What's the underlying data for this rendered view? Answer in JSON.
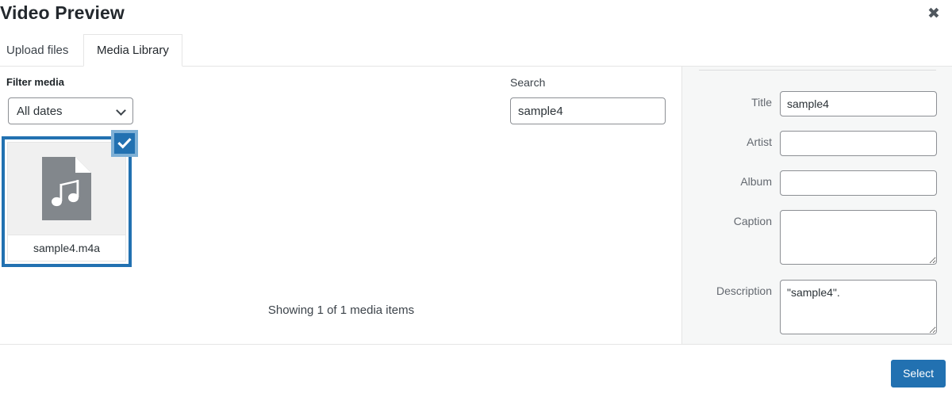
{
  "modal": {
    "title": "Video Preview",
    "close_label": "✖"
  },
  "tabs": [
    {
      "label": "Upload files",
      "active": false
    },
    {
      "label": "Media Library",
      "active": true
    }
  ],
  "toolbar": {
    "filter_label": "Filter media",
    "date_filter_value": "All dates",
    "date_filter_options": [
      "All dates"
    ],
    "search_label": "Search",
    "search_value": "sample4",
    "search_placeholder": ""
  },
  "media": {
    "items": [
      {
        "filename": "sample4.m4a",
        "type": "audio",
        "selected": true
      }
    ],
    "showing_text": "Showing 1 of 1 media items"
  },
  "sidebar": {
    "fields": [
      {
        "label": "Title",
        "value": "sample4",
        "kind": "input"
      },
      {
        "label": "Artist",
        "value": "",
        "kind": "input"
      },
      {
        "label": "Album",
        "value": "",
        "kind": "input"
      },
      {
        "label": "Caption",
        "value": "",
        "kind": "textarea"
      },
      {
        "label": "Description",
        "value": "\"sample4\".",
        "kind": "textarea"
      }
    ]
  },
  "footer": {
    "select_label": "Select"
  },
  "colors": {
    "accent": "#2271b1",
    "accent_light": "#7eb0d6",
    "sidebar_bg": "#f6f7f7",
    "border": "#e5e5e5",
    "text": "#3c434a",
    "icon_gray": "#82878c"
  }
}
